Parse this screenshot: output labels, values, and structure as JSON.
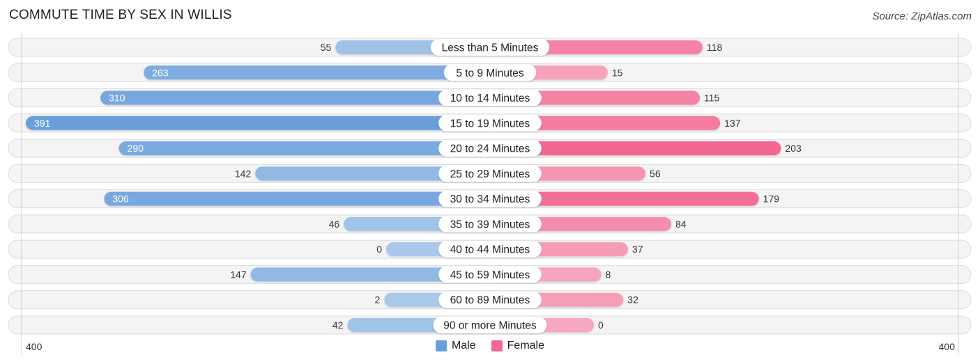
{
  "header": {
    "title": "COMMUTE TIME BY SEX IN WILLIS",
    "source": "Source: ZipAtlas.com"
  },
  "colors": {
    "male_strong": "#6a9fdc",
    "male_light": "#a9c8ea",
    "female_strong": "#f2668f",
    "female_light": "#f7a8c0",
    "row_bg": "#f4f4f4"
  },
  "legend": {
    "male": "Male",
    "female": "Female"
  },
  "chart_data": {
    "type": "bar",
    "orientation": "horizontal-diverging",
    "title": "COMMUTE TIME BY SEX IN WILLIS",
    "categories": [
      "Less than 5 Minutes",
      "5 to 9 Minutes",
      "10 to 14 Minutes",
      "15 to 19 Minutes",
      "20 to 24 Minutes",
      "25 to 29 Minutes",
      "30 to 34 Minutes",
      "35 to 39 Minutes",
      "40 to 44 Minutes",
      "45 to 59 Minutes",
      "60 to 89 Minutes",
      "90 or more Minutes"
    ],
    "series": [
      {
        "name": "Male",
        "side": "left",
        "values": [
          55,
          263,
          310,
          391,
          290,
          142,
          306,
          46,
          0,
          147,
          2,
          42
        ]
      },
      {
        "name": "Female",
        "side": "right",
        "values": [
          118,
          15,
          115,
          137,
          203,
          56,
          179,
          84,
          37,
          8,
          32,
          0
        ]
      }
    ],
    "axis": {
      "left_label": "400",
      "right_label": "400",
      "max": 400
    },
    "legend_position": "bottom-center",
    "value_labels": true
  }
}
